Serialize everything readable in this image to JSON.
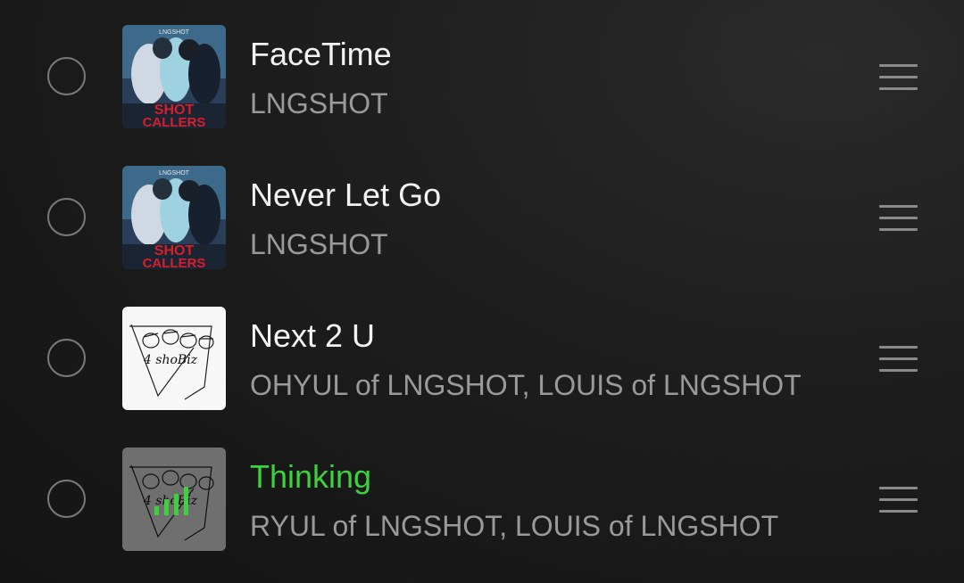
{
  "tracks": [
    {
      "title": "FaceTime",
      "artist": "LNGSHOT",
      "art": "shot-callers-art",
      "playing": false
    },
    {
      "title": "Never Let Go",
      "artist": "LNGSHOT",
      "art": "shot-callers-art",
      "playing": false
    },
    {
      "title": "Next 2 U",
      "artist": "OHYUL of LNGSHOT, LOUIS of LNGSHOT",
      "art": "4shobiz-art",
      "playing": false
    },
    {
      "title": "Thinking",
      "artist": "RYUL of LNGSHOT, LOUIS of LNGSHOT",
      "art": "4shobiz-art",
      "playing": true
    }
  ],
  "album_text": {
    "shot_callers_top": "LNGSHOT",
    "shot_callers_1": "SHOT",
    "shot_callers_2": "CALLERS",
    "sketch_logo": "4 shoBiz"
  },
  "colors": {
    "playing_accent": "#3dd13d",
    "title": "#f2f2f2",
    "artist": "#9a9a9a"
  },
  "icons": {
    "select": "radio-circle-icon",
    "drag": "drag-handle-icon",
    "playing": "equalizer-bars-icon"
  }
}
